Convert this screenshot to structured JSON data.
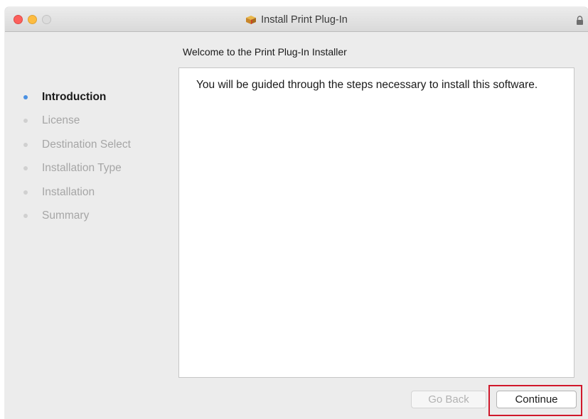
{
  "window": {
    "title": "Install Print Plug-In",
    "title_icon": "package-icon",
    "lock_icon": "lock-icon"
  },
  "heading": "Welcome to the Print Plug-In Installer",
  "sidebar": {
    "steps": [
      {
        "label": "Introduction",
        "active": true
      },
      {
        "label": "License",
        "active": false
      },
      {
        "label": "Destination Select",
        "active": false
      },
      {
        "label": "Installation Type",
        "active": false
      },
      {
        "label": "Installation",
        "active": false
      },
      {
        "label": "Summary",
        "active": false
      }
    ]
  },
  "content": {
    "text": "You will be guided through the steps necessary to install this software."
  },
  "buttons": {
    "back_label": "Go Back",
    "back_enabled": false,
    "continue_label": "Continue"
  },
  "colors": {
    "active_step_dot": "#4a90e2",
    "highlight_box": "#d0182b",
    "traffic_close": "#fc605c",
    "traffic_minimize": "#fdbc40"
  }
}
